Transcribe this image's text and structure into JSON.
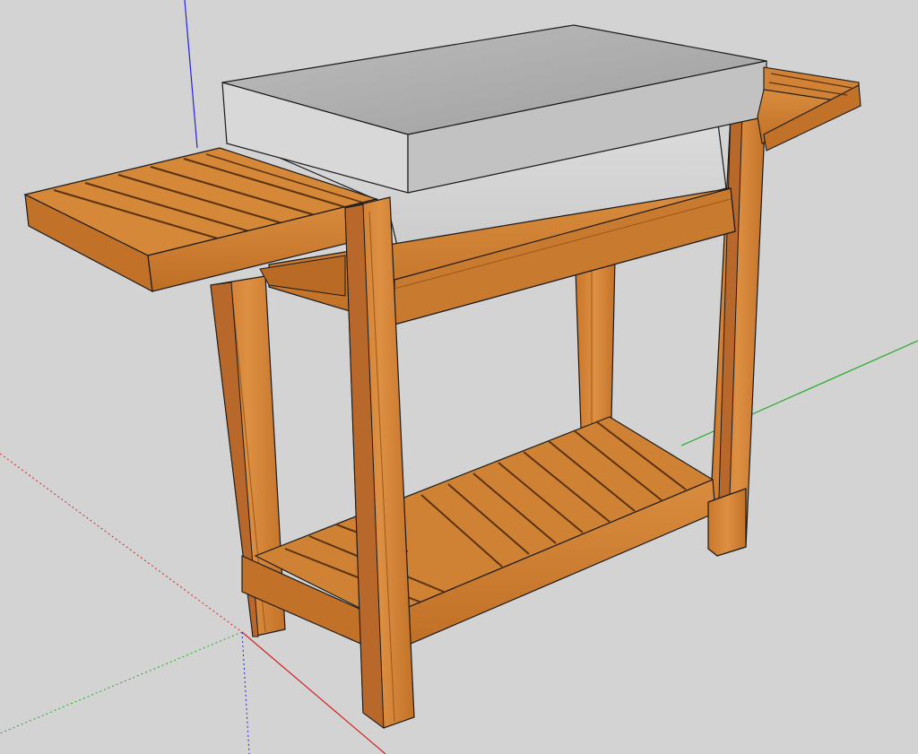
{
  "viewport": {
    "background": "#d3d3d3"
  },
  "axes": {
    "red_axis_color": "#d22222",
    "green_axis_color": "#22aa22",
    "blue_axis_color": "#2222dd"
  },
  "model": {
    "wood_light": "#d88a3c",
    "wood_mid": "#c77a2e",
    "wood_dark": "#a85e1c",
    "wood_slot": "#5a3210",
    "outline": "#1a1a1a",
    "box_top": "#b8b8b8",
    "box_front": "#d6d6d6",
    "box_side": "#c4c4c4"
  }
}
